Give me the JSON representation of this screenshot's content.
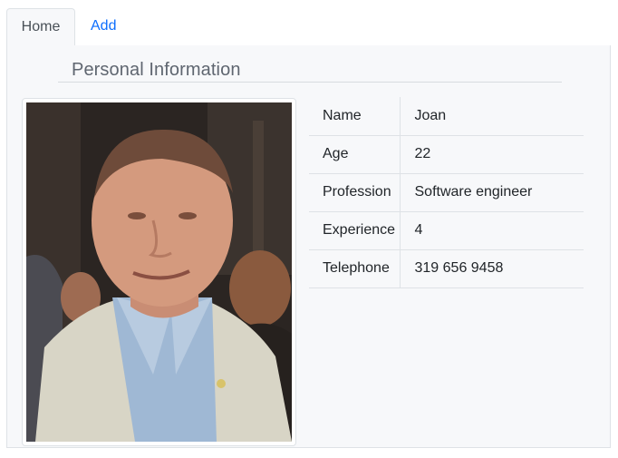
{
  "tabs": [
    {
      "label": "Home",
      "active": true
    },
    {
      "label": "Add",
      "active": false
    }
  ],
  "section": {
    "title": "Personal Information"
  },
  "profile": {
    "photo_icon": "person-photo",
    "fields": [
      {
        "label": "Name",
        "value": "Joan"
      },
      {
        "label": "Age",
        "value": "22"
      },
      {
        "label": "Profession",
        "value": "Software engineer"
      },
      {
        "label": "Experience",
        "value": "4"
      },
      {
        "label": "Telephone",
        "value": "319 656 9458"
      }
    ]
  },
  "colors": {
    "link": "#0d6efd",
    "panel_bg": "#f7f8fa",
    "border": "#dee2e6"
  }
}
